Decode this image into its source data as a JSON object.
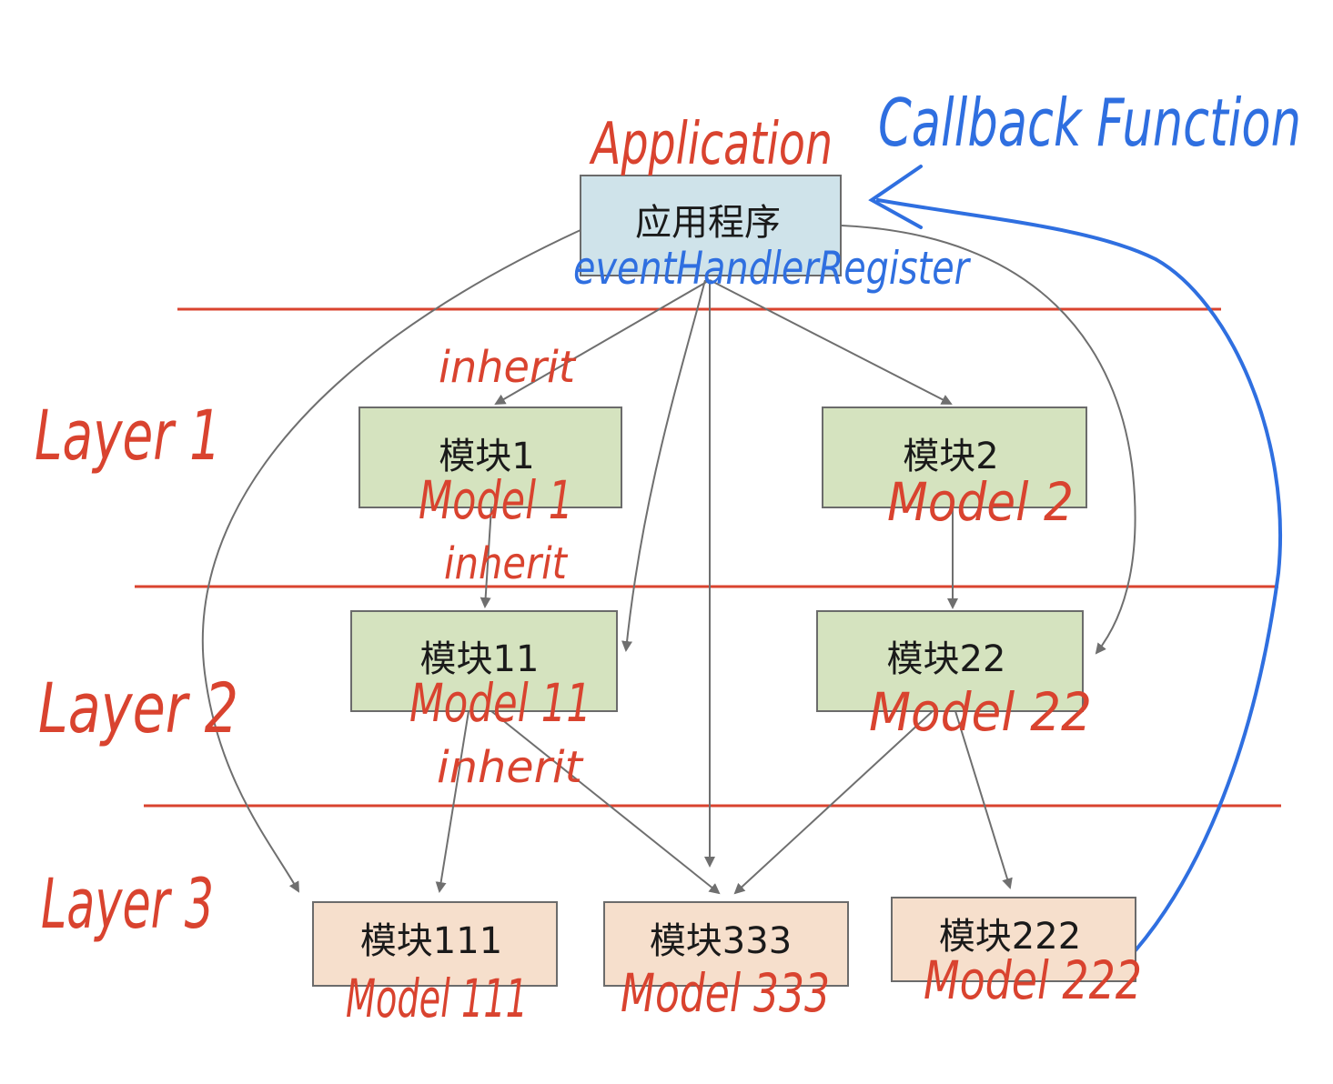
{
  "colors": {
    "app_box_fill": "#cfe3ea",
    "layer_box_fill": "#d5e3bf",
    "leaf_box_fill": "#f6dfcc",
    "box_border": "#6b6b6b",
    "arrow": "#6f6f6f",
    "red_annotation": "#d9432f",
    "blue_annotation": "#2f6fe0"
  },
  "annotations": {
    "application": "Application",
    "callback": "Callback Function",
    "event_handler": "eventHandlerRegister",
    "layer1": "Layer 1",
    "layer2": "Layer 2",
    "layer3": "Layer 3",
    "inherit1": "inherit",
    "inherit2": "inherit",
    "inherit3": "inherit"
  },
  "boxes": {
    "app": {
      "label": "应用程序"
    },
    "m1": {
      "label": "模块1",
      "note": "Model 1"
    },
    "m2": {
      "label": "模块2",
      "note": "Model 2"
    },
    "m11": {
      "label": "模块11",
      "note": "Model 11"
    },
    "m22": {
      "label": "模块22",
      "note": "Model 22"
    },
    "m111": {
      "label": "模块111",
      "note": "Model 111"
    },
    "m333": {
      "label": "模块333",
      "note": "Model 333"
    },
    "m222": {
      "label": "模块222",
      "note": "Model 222"
    }
  }
}
